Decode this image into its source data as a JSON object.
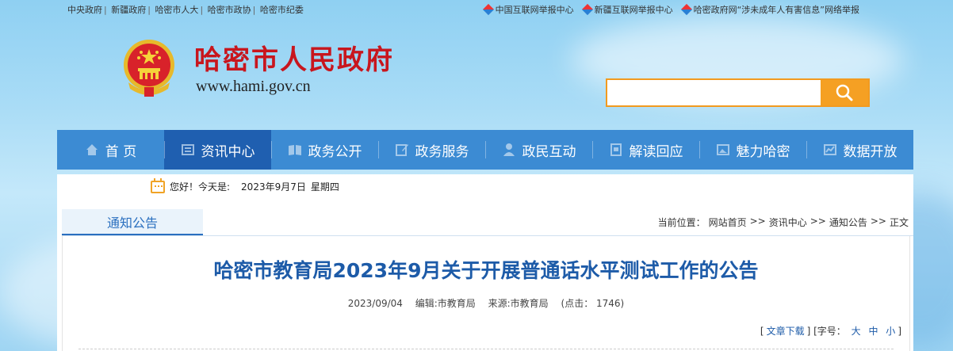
{
  "top_links": [
    "中央政府",
    "新疆政府",
    "哈密市人大",
    "哈密市政协",
    "哈密市纪委"
  ],
  "report_links": [
    "中国互联网举报中心",
    "新疆互联网举报中心",
    "哈密政府网“涉未成年人有害信息”网络举报"
  ],
  "site": {
    "title": "哈密市人民政府",
    "url": "www.hami.gov.cn"
  },
  "search": {
    "placeholder": "",
    "value": ""
  },
  "nav": [
    {
      "label": "首 页",
      "icon": "home-icon"
    },
    {
      "label": "资讯中心",
      "icon": "news-icon",
      "active": true
    },
    {
      "label": "政务公开",
      "icon": "book-icon"
    },
    {
      "label": "政务服务",
      "icon": "edit-icon"
    },
    {
      "label": "政民互动",
      "icon": "user-icon"
    },
    {
      "label": "解读回应",
      "icon": "document-icon"
    },
    {
      "label": "魅力哈密",
      "icon": "landscape-icon"
    },
    {
      "label": "数据开放",
      "icon": "chart-icon"
    }
  ],
  "datebar": {
    "greeting": "您好！今天是:",
    "date": "2023年9月7日",
    "weekday": "星期四"
  },
  "section": {
    "tab": "通知公告"
  },
  "breadcrumb": {
    "prefix": "当前位置：",
    "items": [
      "网站首页",
      "资讯中心",
      "通知公告",
      "正文"
    ],
    "sep": ">>"
  },
  "article": {
    "title": "哈密市教育局2023年9月关于开展普通话水平测试工作的公告",
    "date": "2023/09/04",
    "editor": "编辑:市教育局",
    "source": "来源:市教育局",
    "hits": "(点击：  1746)"
  },
  "tools": {
    "download": "文章下载",
    "font_label": "字号：",
    "sizes": [
      "大",
      "中",
      "小"
    ]
  },
  "colors": {
    "nav": "#3c8bd3",
    "nav_active": "#1f5fb0",
    "title_red": "#c8161d",
    "search_orange": "#f5a023",
    "article_title": "#1d5ba8"
  }
}
